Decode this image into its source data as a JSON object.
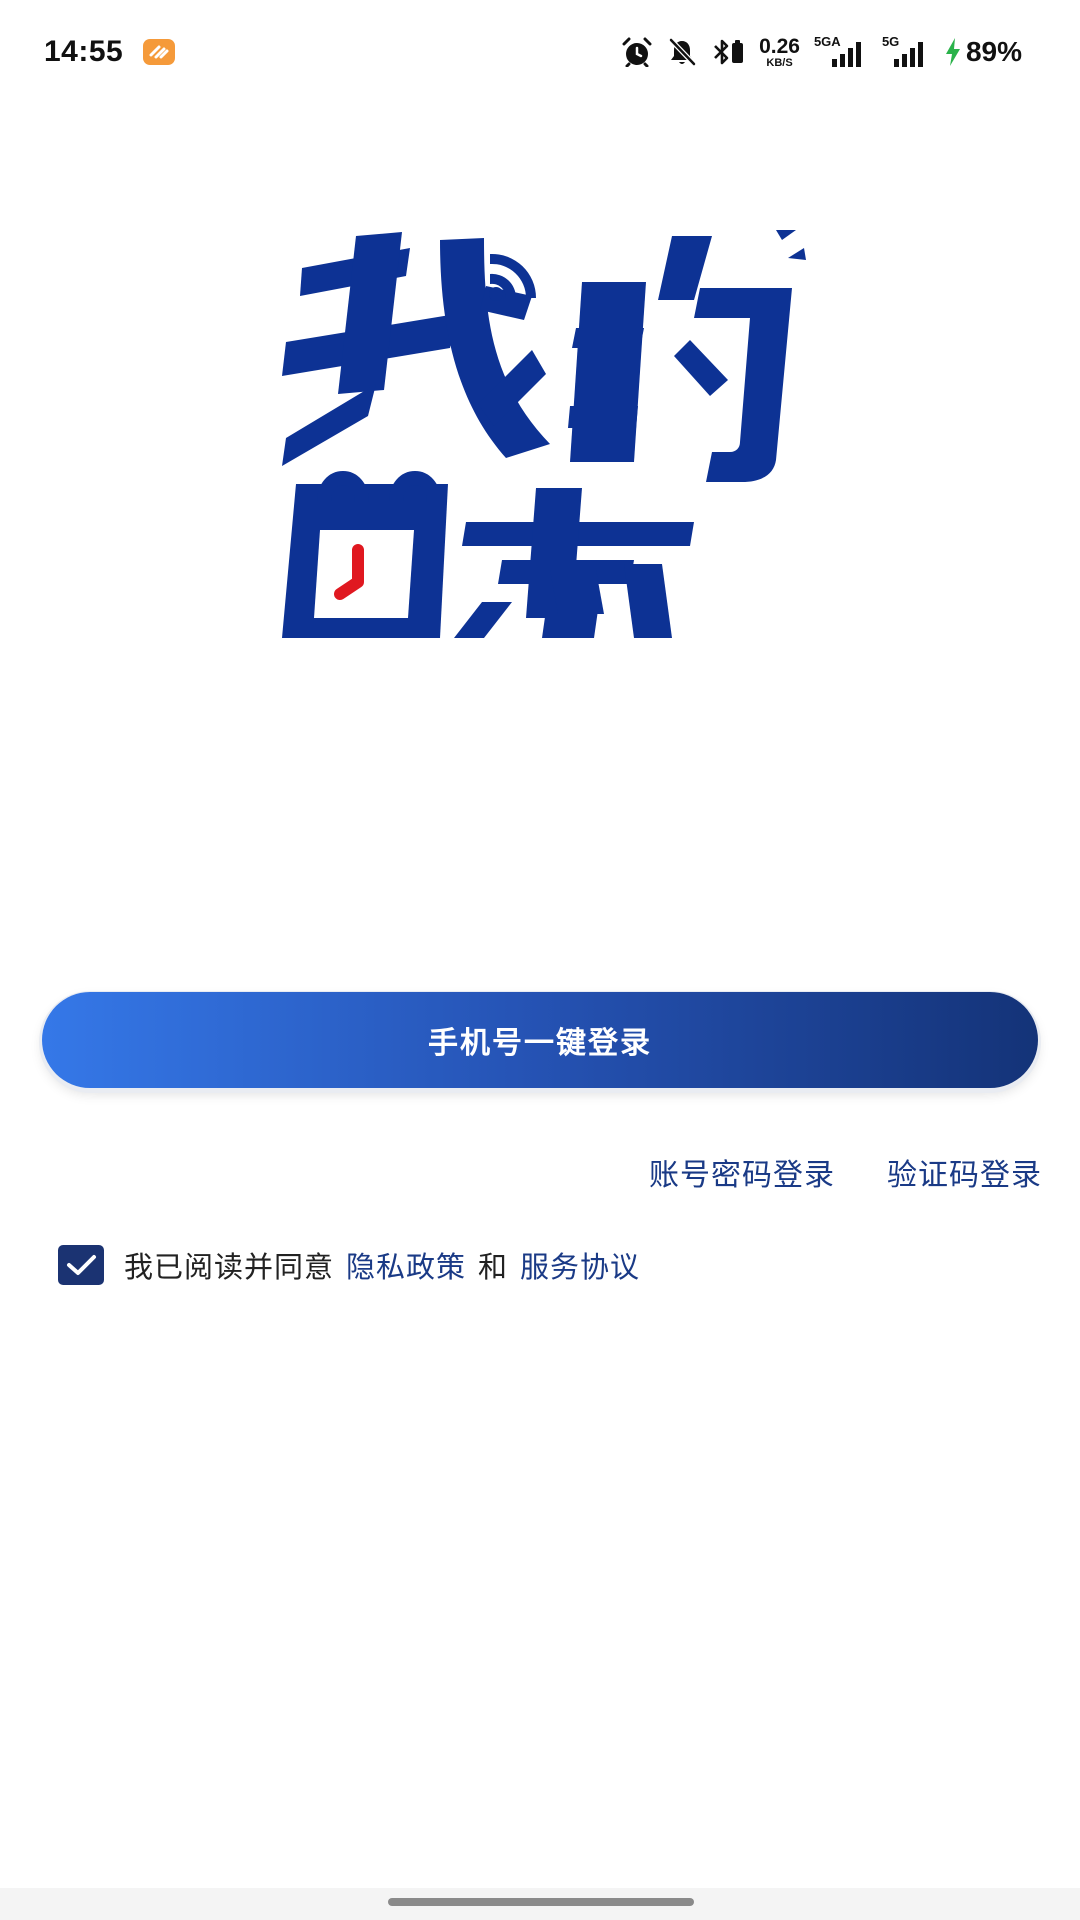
{
  "status_bar": {
    "time": "14:55",
    "net_speed_value": "0.26",
    "net_speed_unit": "KB/S",
    "sim1_label": "5GA",
    "sim2_label": "5G",
    "battery": "89%",
    "icons": [
      "app-notification-icon",
      "alarm-icon",
      "bell-muted-icon",
      "bluetooth-icon",
      "signal-icon",
      "charging-bolt-icon"
    ]
  },
  "logo": {
    "line1": "我的",
    "line2": "日志",
    "brand_color": "#0d3294",
    "accent_color": "#e01820"
  },
  "login": {
    "primary_label": "手机号一键登录",
    "gradient_start": "#3578e8",
    "gradient_end": "#143378"
  },
  "alt_login": {
    "password_label": "账号密码登录",
    "code_label": "验证码登录"
  },
  "agreement": {
    "checked": true,
    "prefix": "我已阅读并同意",
    "privacy_label": "隐私政策",
    "joiner": "和",
    "service_label": "服务协议"
  }
}
